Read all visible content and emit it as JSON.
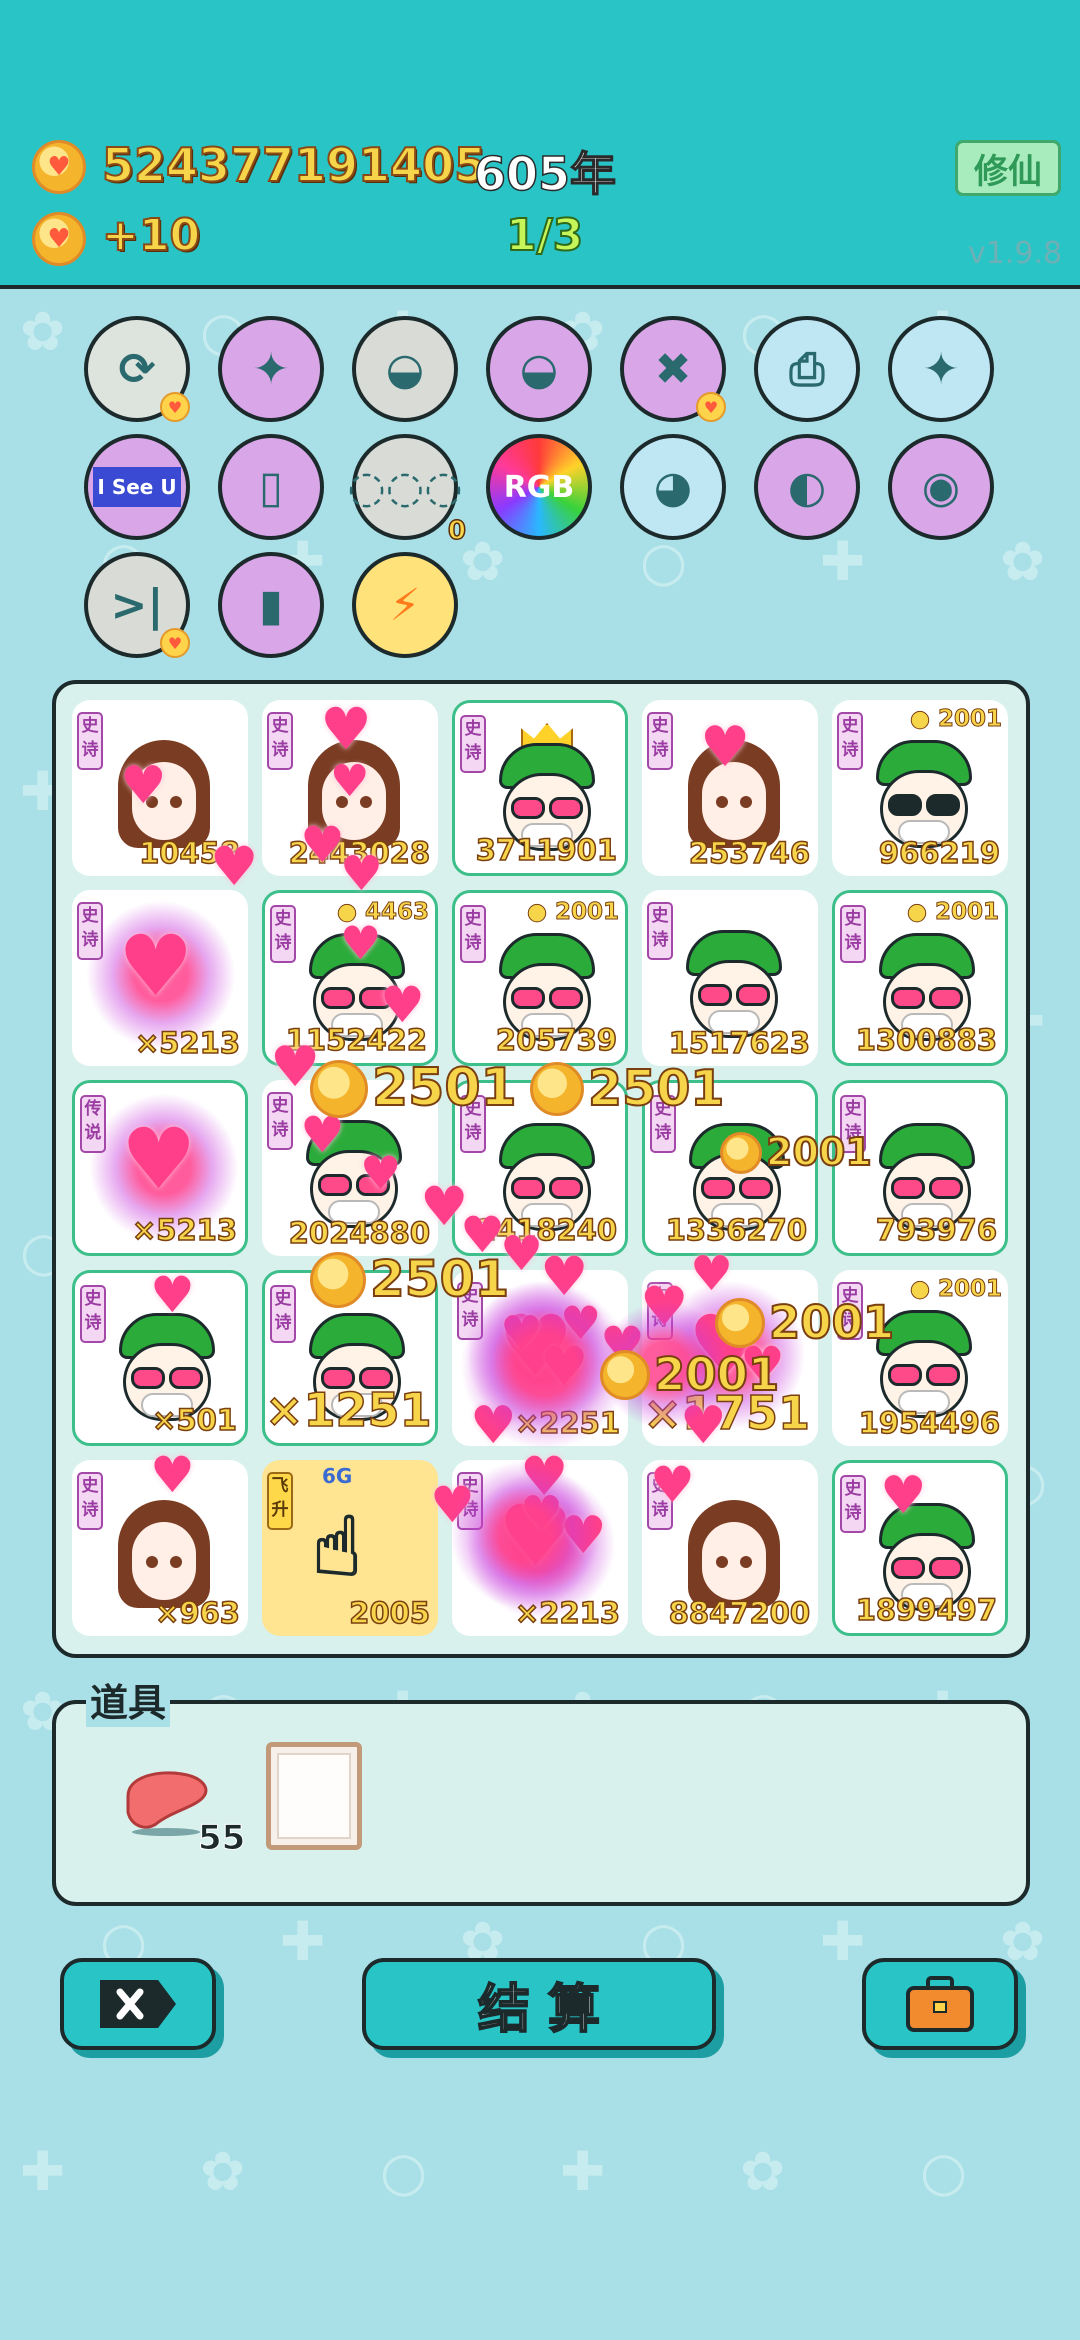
{
  "header": {
    "coins": "524377191405",
    "year": "605年",
    "rate": "+10",
    "progress": "1/3",
    "cultivate_label": "修仙",
    "version": "v1.9.8"
  },
  "top_icons": [
    {
      "name": "refresh-icon",
      "glyph": "⟳",
      "bg": "#dde3dd",
      "badge": true
    },
    {
      "name": "compass-icon",
      "glyph": "✦",
      "bg": "#d9a6e8"
    },
    {
      "name": "dog-bowl-icon",
      "glyph": "◒",
      "bg": "#d9dcd6"
    },
    {
      "name": "dog-bowl-icon-2",
      "glyph": "◒",
      "bg": "#d9a6e8"
    },
    {
      "name": "delete-tag-icon",
      "glyph": "✖",
      "bg": "#d9a6e8",
      "badge": true
    },
    {
      "name": "printer-icon",
      "glyph": "⎙",
      "bg": "#bfe7f3"
    },
    {
      "name": "compass-icon-2",
      "glyph": "✦",
      "bg": "#bfe7f3"
    },
    {
      "name": "i-see-u-icon",
      "glyph": "I See U",
      "bg": "#d9a6e8"
    },
    {
      "name": "jar-icon",
      "glyph": "▯",
      "bg": "#d9a6e8"
    },
    {
      "name": "egg-tray-icon",
      "glyph": "◌◌◌",
      "bg": "#d9dcd6",
      "count": "0"
    },
    {
      "name": "rgb-icon",
      "glyph": "RGB",
      "bg": "rainbow"
    },
    {
      "name": "chick-icon",
      "glyph": "◕",
      "bg": "#bfe7f3"
    },
    {
      "name": "eyepatch-icon",
      "glyph": "◐",
      "bg": "#d9a6e8"
    },
    {
      "name": "egg-icon",
      "glyph": "◉",
      "bg": "#d9a6e8"
    },
    {
      "name": "skip-icon",
      "glyph": ">|",
      "bg": "#d9dcd6",
      "badge": true
    },
    {
      "name": "traffic-light-icon",
      "glyph": "▮",
      "bg": "#d9a6e8"
    },
    {
      "name": "lightning-icon",
      "glyph": "⚡",
      "bg": "#ffe27a"
    }
  ],
  "grid": [
    [
      {
        "value": "10458",
        "type": "girl",
        "tag": "史诗"
      },
      {
        "value": "2443028",
        "type": "girl",
        "tag": "史诗"
      },
      {
        "value": "3711901",
        "type": "green",
        "tag": "史诗",
        "hl": true,
        "crown": true
      },
      {
        "value": "253746",
        "type": "girl",
        "tag": "史诗"
      },
      {
        "value": "966219",
        "type": "green-dark",
        "tag": "史诗",
        "bonus": "2001"
      }
    ],
    [
      {
        "value": "×5213",
        "type": "glow",
        "tag": "史诗"
      },
      {
        "value": "1152422",
        "type": "green",
        "tag": "史诗",
        "hl": true,
        "bonus": "4463"
      },
      {
        "value": "205739",
        "type": "green",
        "tag": "史诗",
        "hl": true,
        "bonus": "2001"
      },
      {
        "value": "1517623",
        "type": "green",
        "tag": "史诗"
      },
      {
        "value": "1300883",
        "type": "green",
        "tag": "史诗",
        "hl": true,
        "bonus": "2001"
      }
    ],
    [
      {
        "value": "×5213",
        "type": "glow",
        "tag": "传说",
        "hl": true
      },
      {
        "value": "2024880",
        "type": "green",
        "tag": "史诗"
      },
      {
        "value": "1418240",
        "type": "green",
        "tag": "史诗",
        "hl": true
      },
      {
        "value": "1336270",
        "type": "green",
        "tag": "史诗",
        "hl": true
      },
      {
        "value": "793976",
        "type": "green",
        "tag": "史诗",
        "hl": true
      }
    ],
    [
      {
        "value": "×501",
        "type": "green",
        "tag": "史诗",
        "hl": true
      },
      {
        "value": "×1251",
        "type": "green",
        "tag": "史诗",
        "hl": true
      },
      {
        "value": "×2251",
        "type": "glow",
        "tag": "史诗"
      },
      {
        "value": "×1751",
        "type": "glow",
        "tag": "史诗"
      },
      {
        "value": "1954496",
        "type": "green",
        "tag": "史诗",
        "bonus": "2001"
      }
    ],
    [
      {
        "value": "×963",
        "type": "girl",
        "tag": "史诗"
      },
      {
        "value": "2005",
        "type": "hand",
        "tag": "飞升",
        "yellow": true,
        "label": "6G"
      },
      {
        "value": "×2213",
        "type": "glow",
        "tag": "史诗"
      },
      {
        "value": "8847200",
        "type": "girl",
        "tag": "史诗"
      },
      {
        "value": "1899497",
        "type": "green",
        "tag": "史诗",
        "hl": true
      }
    ]
  ],
  "popups": [
    "2501",
    "2501",
    "2501",
    "2001",
    "2001",
    "2001"
  ],
  "items_section": {
    "title": "道具",
    "items": [
      {
        "name": "liver-item",
        "count": "55"
      },
      {
        "name": "frame-item",
        "count": ""
      }
    ]
  },
  "bottom": {
    "settle_label": "结 算"
  }
}
